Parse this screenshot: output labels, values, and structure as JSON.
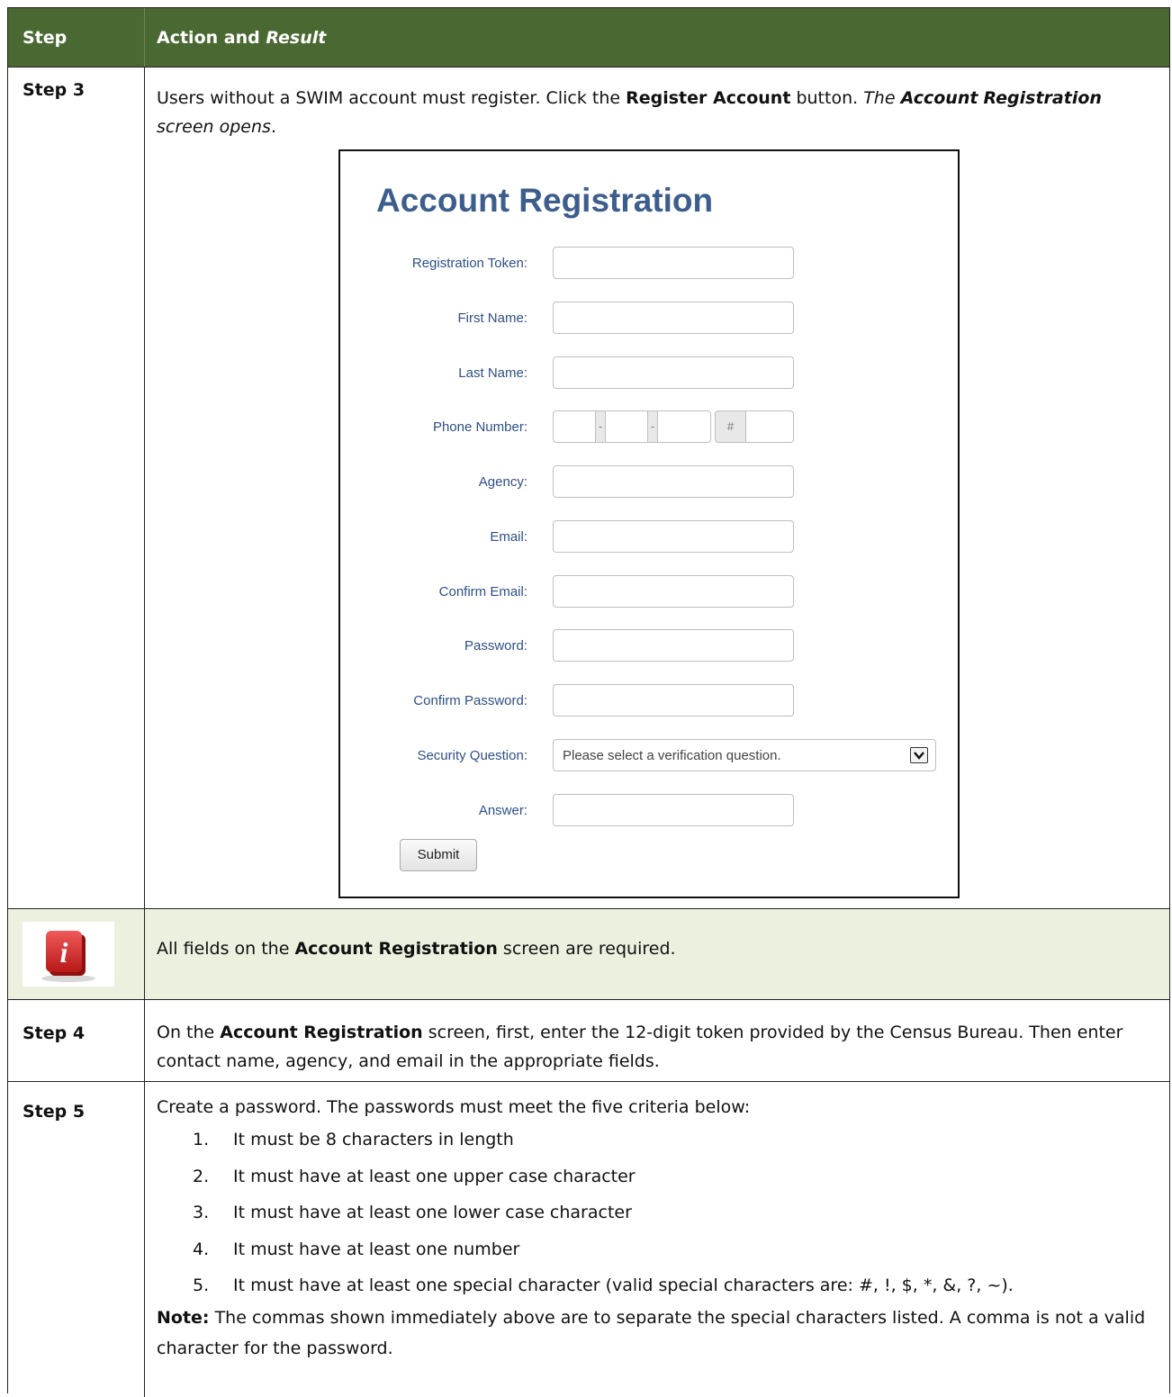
{
  "header": {
    "step": "Step",
    "action": "Action and",
    "result": "Result"
  },
  "step3": {
    "label": "Step 3",
    "text_1": "Users without a SWIM account must register. Click the ",
    "bold_1": "Register Account",
    "text_2": " button. ",
    "italic_1": "The ",
    "bold_italic_1": "Account",
    "bold_italic_2": "Registration",
    "italic_2": " screen opens",
    "text_3": "."
  },
  "form": {
    "title": "Account Registration",
    "fields": [
      {
        "label": "Registration Token:"
      },
      {
        "label": "First Name:"
      },
      {
        "label": "Last Name:"
      },
      {
        "label": "Phone Number:"
      },
      {
        "label": "Agency:"
      },
      {
        "label": "Email:"
      },
      {
        "label": "Confirm Email:"
      },
      {
        "label": "Password:"
      },
      {
        "label": "Confirm Password:"
      },
      {
        "label": "Security Question:"
      },
      {
        "label": "Answer:"
      }
    ],
    "phone_sep": "-",
    "phone_ext": "#",
    "security_placeholder": "Please select a verification question.",
    "submit": "Submit"
  },
  "info_note": {
    "text_1": "All fields on the ",
    "bold": "Account Registration",
    "text_2": " screen are required."
  },
  "step4": {
    "label": "Step 4",
    "text_1": "On the ",
    "bold": "Account Registration",
    "text_2": " screen, first, enter the 12-digit token provided by the Census Bureau. Then enter contact name, agency, and email in the appropriate fields."
  },
  "step5": {
    "label": "Step 5",
    "intro": "Create a password. The passwords must meet the five criteria below:",
    "criteria": [
      {
        "num": "1.",
        "text": "It must be 8 characters in length"
      },
      {
        "num": "2.",
        "text": "It must have at least one upper case character"
      },
      {
        "num": "3.",
        "text": "It must have at least one lower case character"
      },
      {
        "num": "4.",
        "text": "It must have at least one number"
      },
      {
        "num": "5.",
        "text": "It must have at least one special character (valid special characters are: #, !, $, *, &, ?, ~)."
      }
    ],
    "note_label": "Note:",
    "note_text": "  The commas shown immediately above are to separate the special characters listed. A comma is not a valid character for the password."
  },
  "colors": {
    "header_bg": "#4a6832",
    "note_bg": "#ebf1de",
    "form_title": "#3d5e8c",
    "form_label": "#2e4f86",
    "info_icon": "#d42a2a"
  }
}
